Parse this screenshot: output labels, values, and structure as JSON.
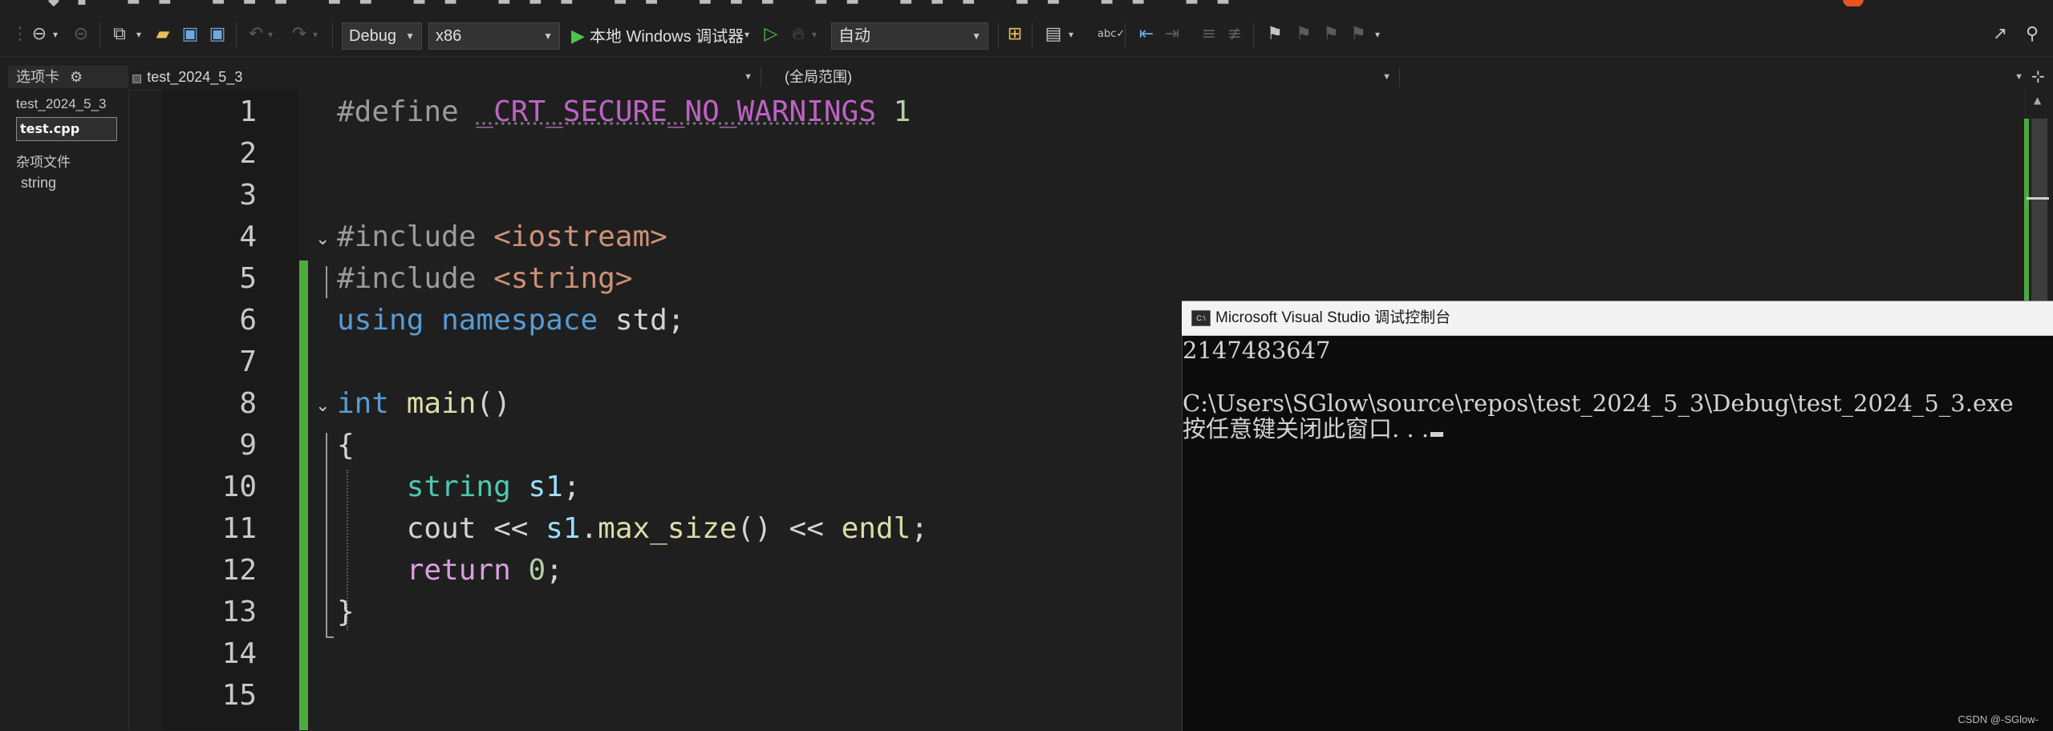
{
  "toolbar": {
    "config": "Debug",
    "platform": "x86",
    "run_label": "本地 Windows 调试器",
    "stack_frame": "自动",
    "icons": [
      "back-icon",
      "forward-icon",
      "new-project-icon",
      "open-folder-icon",
      "save-icon",
      "save-all-icon",
      "undo-icon",
      "redo-icon",
      "start-without-debug-icon",
      "hot-reload-icon",
      "solution-explorer-icon",
      "layout-icon",
      "spellcheck-icon",
      "breakpoint-icon",
      "comment-icon",
      "uncomment-icon",
      "bookmark-icon",
      "share-icon",
      "feedback-icon"
    ]
  },
  "left_pane": {
    "header": "选项卡",
    "project": "test_2024_5_3",
    "active_file": "test.cpp",
    "misc_group": "杂项文件",
    "misc_item": "string"
  },
  "navbar": {
    "project": "test_2024_5_3",
    "scope": "(全局范围)",
    "member": ""
  },
  "editor": {
    "line_numbers": [
      "1",
      "2",
      "3",
      "4",
      "5",
      "6",
      "7",
      "8",
      "9",
      "10",
      "11",
      "12",
      "13",
      "14",
      "15"
    ],
    "lines": {
      "l1": {
        "directive": "#define",
        "macro": "_CRT_SECURE_NO_WARNINGS",
        "value": "1"
      },
      "l4": {
        "directive": "#include",
        "header": "<iostream>"
      },
      "l5": {
        "directive": "#include",
        "header": "<string>"
      },
      "l6": {
        "kw1": "using",
        "kw2": "namespace",
        "rest": "std;"
      },
      "l8": {
        "type": "int",
        "fn": "main",
        "rest": "()"
      },
      "l9": {
        "text": "{"
      },
      "l10": {
        "type": "string",
        "var": "s1",
        "rest": ";"
      },
      "l11": {
        "p1": "cout << ",
        "var": "s1",
        "dot": ".",
        "fn": "max_size",
        "p2": "() << ",
        "fn2": "endl",
        "p3": ";"
      },
      "l12": {
        "kw": "return",
        "num": "0",
        "rest": ";"
      },
      "l13": {
        "text": "}"
      }
    }
  },
  "console": {
    "title": "Microsoft Visual Studio 调试控制台",
    "icon_text": "C:\\",
    "output_line1": "2147483647",
    "output_line2": "",
    "output_line3": "C:\\Users\\SGlow\\source\\repos\\test_2024_5_3\\Debug\\test_2024_5_3.exe",
    "output_line4": "按任意键关闭此窗口. . ."
  },
  "watermark": "CSDN @-SGlow-",
  "colors": {
    "background": "#1f1f1f",
    "keyword": "#569cd6",
    "type": "#4ec9b0",
    "function": "#dcdcaa",
    "string": "#ce9178",
    "change_bar": "#4caa41",
    "notification": "#e9541f"
  }
}
